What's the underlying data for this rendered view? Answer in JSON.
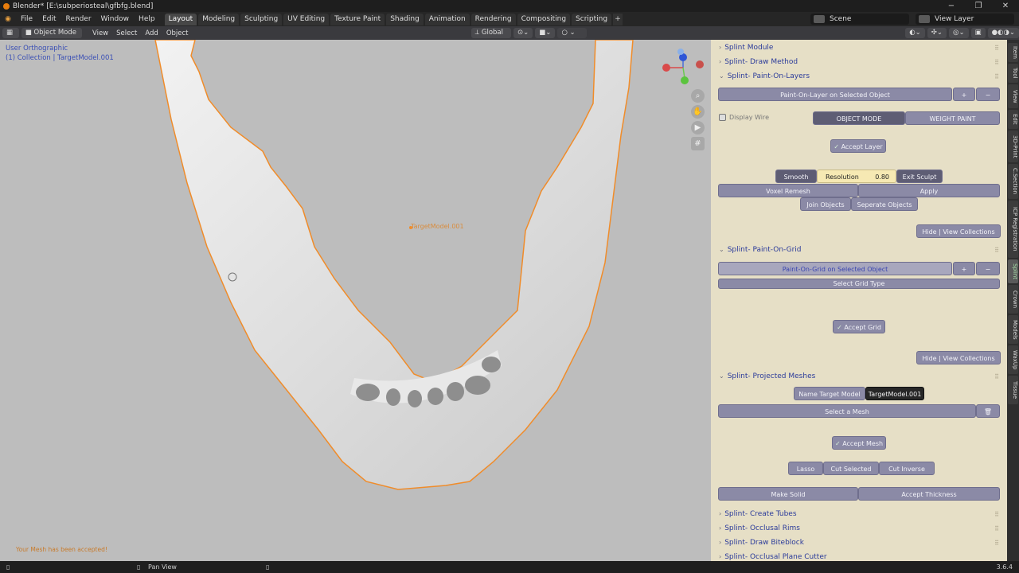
{
  "window": {
    "title": "Blender* [E:\\subperiosteal\\gfbfg.blend]"
  },
  "menu": [
    "File",
    "Edit",
    "Render",
    "Window",
    "Help"
  ],
  "workspaces": [
    "Layout",
    "Modeling",
    "Sculpting",
    "UV Editing",
    "Texture Paint",
    "Shading",
    "Animation",
    "Rendering",
    "Compositing",
    "Scripting"
  ],
  "active_workspace": "Layout",
  "scene": "Scene",
  "view_layer": "View Layer",
  "viewport_header": {
    "mode": "Object Mode",
    "menus": [
      "View",
      "Select",
      "Add",
      "Object"
    ],
    "orientation": "Global"
  },
  "viewport": {
    "view_name": "User Orthographic",
    "collection": "(1) Collection | TargetModel.001",
    "object_label": "TargetModel.001",
    "message": "Your Mesh has been accepted!"
  },
  "sidebar": {
    "panels": {
      "module": "Splint Module",
      "draw_method": "Splint- Draw Method",
      "paint_on_layers": "Splint- Paint-On-Layers",
      "paint_on_grid": "Splint- Paint-On-Grid",
      "projected_meshes": "Splint- Projected Meshes",
      "create_tubes": "Splint- Create Tubes",
      "occlusal_rims": "Splint- Occlusal Rims",
      "draw_biteblock": "Splint- Draw Biteblock",
      "occlusal_plane_cutter": "Splint- Occlusal Plane Cutter"
    },
    "layers": {
      "paint_button": "Paint-On-Layer on Selected Object",
      "plus": "+",
      "minus": "−",
      "display_wire": "Display Wire",
      "object_mode": "OBJECT MODE",
      "weight_paint": "WEIGHT PAINT",
      "accept_layer": "Accept Layer",
      "smooth": "Smooth",
      "resolution_label": "Resolution",
      "resolution_value": "0.80",
      "exit_sculpt": "Exit Sculpt",
      "voxel_remesh": "Voxel Remesh",
      "apply": "Apply",
      "join_objects": "Join Objects",
      "separate_objects": "Seperate Objects",
      "hide_view_collections": "Hide | View Collections"
    },
    "grid": {
      "paint_button": "Paint-On-Grid on Selected Object",
      "plus": "+",
      "minus": "−",
      "select_grid_type": "Select Grid Type",
      "accept_grid": "Accept Grid",
      "hide_view_collections": "Hide | View Collections"
    },
    "projected": {
      "name_target_model": "Name Target Model",
      "target_model_value": "TargetModel.001",
      "select_mesh": "Select a Mesh",
      "accept_mesh": "Accept Mesh",
      "lasso": "Lasso",
      "cut_selected": "Cut Selected",
      "cut_inverse": "Cut Inverse",
      "make_solid": "Make Solid",
      "accept_thickness": "Accept Thickness"
    }
  },
  "tabs": [
    "Item",
    "Tool",
    "View",
    "Edit",
    "3D-Print",
    "C.Section",
    "ICP Registration",
    "Splint",
    "Crown",
    "Models",
    "WaxUp",
    "Tissue"
  ],
  "active_tab": "Splint",
  "status": {
    "pan_view": "Pan View",
    "version": "3.6.4"
  },
  "colors": {
    "selection_outline": "#f08c2a",
    "panel_bg": "#e6dfc6",
    "button": "#8b8aa6",
    "title_text": "#2b3b9a"
  }
}
